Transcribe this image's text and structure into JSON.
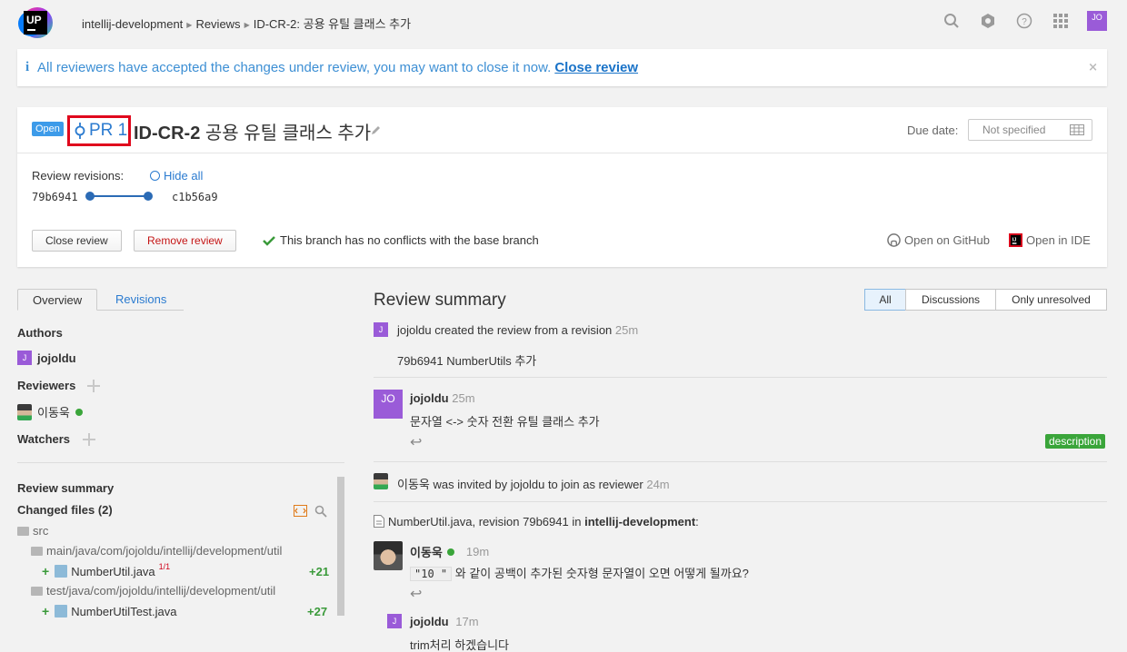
{
  "topbar": {
    "logo_text": "UP",
    "breadcrumb": [
      "intellij-development",
      "Reviews",
      "ID-CR-2: 공용 유틸 클래스 추가"
    ],
    "user_initials": "JO"
  },
  "banner": {
    "message": "All reviewers have accepted the changes under review, you may want to close it now.",
    "link": "Close review",
    "close": "×"
  },
  "review": {
    "status": "Open",
    "pr_label": "PR 1",
    "id": "ID-CR-2",
    "title": "공용 유틸 클래스 추가",
    "due_label": "Due date:",
    "due_value": "Not specified",
    "revisions_label": "Review revisions:",
    "hide_all": "Hide all",
    "rev_from": "79b6941",
    "rev_to": "c1b56a9",
    "close_btn": "Close review",
    "remove_btn": "Remove review",
    "conflict_msg": "This branch has no conflicts with the base branch",
    "open_github": "Open on GitHub",
    "open_ide": "Open in IDE"
  },
  "sidebar": {
    "tabs": [
      "Overview",
      "Revisions"
    ],
    "authors_label": "Authors",
    "author": "jojoldu",
    "reviewers_label": "Reviewers",
    "reviewer": "이동욱",
    "watchers_label": "Watchers",
    "summary_label": "Review summary",
    "changed_files_label": "Changed files (2)",
    "tree": {
      "root": "src",
      "main_dir": "main/java/com/jojoldu/intellij/development/util",
      "main_file": "NumberUtil.java",
      "main_sup": "1/1",
      "main_count": "+21",
      "test_dir": "test/java/com/jojoldu/intellij/development/util",
      "test_file": "NumberUtilTest.java",
      "test_count": "+27"
    }
  },
  "summary": {
    "title": "Review summary",
    "filters": [
      "All",
      "Discussions",
      "Only unresolved"
    ],
    "ev1": {
      "avatar": "J",
      "text": "jojoldu created the review from a revision",
      "time": "25m",
      "commit": "79b6941 NumberUtils 추가"
    },
    "ev2": {
      "avatar": "JO",
      "author": "jojoldu",
      "time": "25m",
      "text": "문자열 <-> 숫자 전환 유틸 클래스 추가",
      "badge": "description"
    },
    "ev3": {
      "text": "이동욱 was invited by jojoldu to join as reviewer",
      "time": "24m"
    },
    "ev4": {
      "file_text": "NumberUtil.java, revision 79b6941 in",
      "repo": "intellij-development",
      "suffix": ":"
    },
    "ev5": {
      "author": "이동욱",
      "time": "19m",
      "code": "\"10 \"",
      "text": "와 같이 공백이 추가된 숫자형 문자열이 오면 어떻게 될까요?"
    },
    "ev6": {
      "avatar": "J",
      "author": "jojoldu",
      "time": "17m",
      "text": "trim처리 하겠습니다"
    }
  }
}
